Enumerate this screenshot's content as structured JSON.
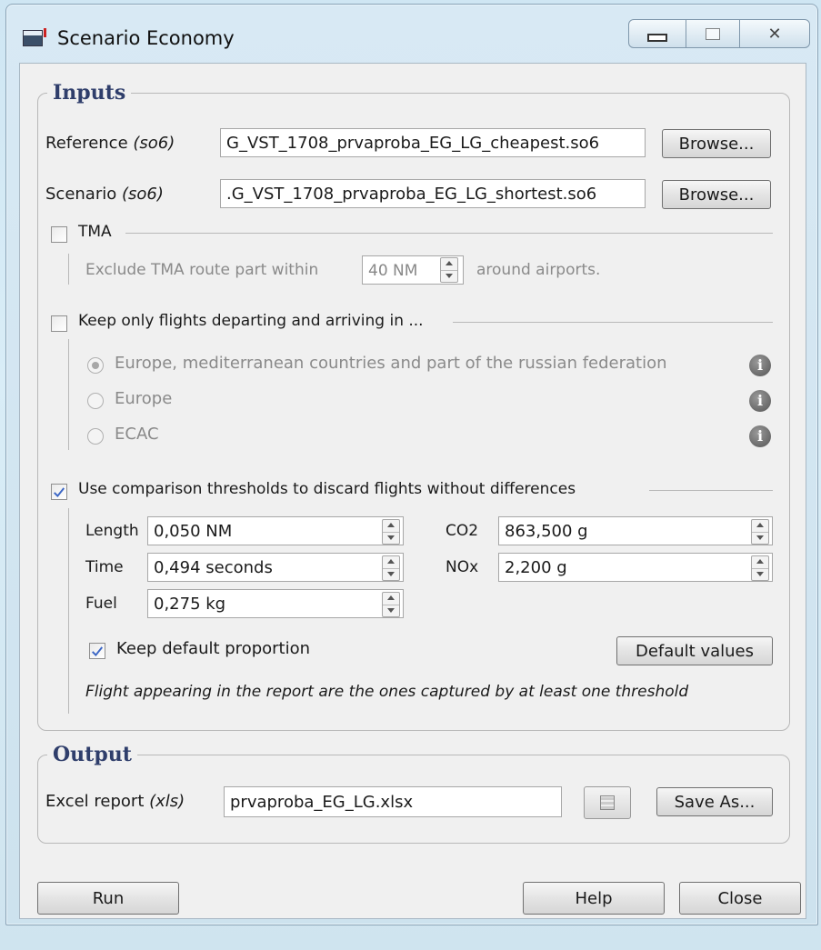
{
  "window": {
    "title": "Scenario Economy"
  },
  "inputs": {
    "group_title": "Inputs",
    "reference": {
      "label": "Reference ",
      "label_fmt": "(so6)",
      "value": "G_VST_1708_prvaproba_EG_LG_cheapest.so6",
      "browse": "Browse..."
    },
    "scenario": {
      "label": "Scenario ",
      "label_fmt": "(so6)",
      "value": ".G_VST_1708_prvaproba_EG_LG_shortest.so6",
      "browse": "Browse..."
    },
    "tma": {
      "label": "TMA",
      "checked": false,
      "exclude_prefix": "Exclude TMA route part within",
      "distance": "40 NM",
      "exclude_suffix": "around airports."
    },
    "keep_only": {
      "label": "Keep only flights departing and arriving in ...",
      "checked": false,
      "options": [
        {
          "label": "Europe, mediterranean countries and part of the russian federation",
          "selected": true
        },
        {
          "label": "Europe",
          "selected": false
        },
        {
          "label": "ECAC",
          "selected": false
        }
      ]
    },
    "thresholds": {
      "label": "Use comparison thresholds to discard flights without differences",
      "checked": true,
      "length": {
        "label": "Length",
        "value": "0,050 NM"
      },
      "time": {
        "label": "Time",
        "value": "0,494 seconds"
      },
      "fuel": {
        "label": "Fuel",
        "value": "0,275 kg"
      },
      "co2": {
        "label": "CO2",
        "value": "863,500 g"
      },
      "nox": {
        "label": "NOx",
        "value": "2,200 g"
      },
      "keep_default": {
        "label": "Keep default proportion",
        "checked": true
      },
      "default_values": "Default values",
      "note": "Flight appearing in the report are the ones captured by at least one threshold"
    }
  },
  "output": {
    "group_title": "Output",
    "excel": {
      "label": "Excel report ",
      "label_fmt": "(xls)",
      "value": "prvaproba_EG_LG.xlsx",
      "save_as": "Save As..."
    }
  },
  "footer": {
    "run": "Run",
    "help": "Help",
    "close": "Close"
  }
}
